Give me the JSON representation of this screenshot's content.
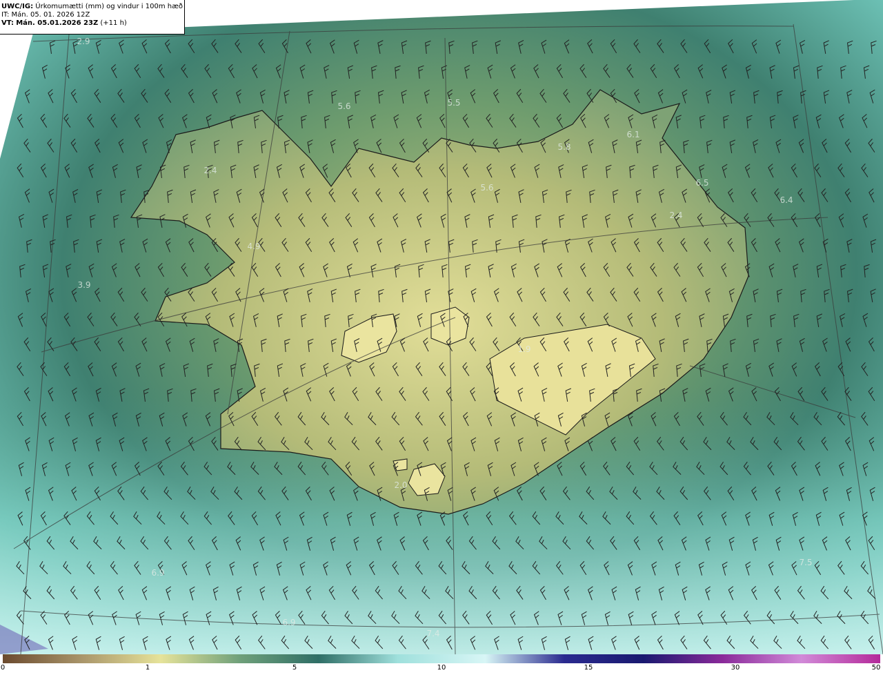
{
  "title": {
    "product": "UWC/IG:",
    "description": "Úrkomumætti (mm) og vindur i 100m hæð",
    "it": "IT: Mán. 05. 01. 2026 12Z",
    "vt_prefix": "VT:",
    "vt_value": "Mán. 05.01.2026 23Z",
    "vt_offset": "(+11 h)"
  },
  "value_labels": [
    "2.9",
    "5.6",
    "5.5",
    "6.1",
    "5.8",
    "2.4",
    "5.6",
    "6.5",
    "6.4",
    "2.4",
    "4.9",
    "3.9",
    "1.9",
    "2.0",
    "6.9",
    "6.9",
    "7.5",
    "7.4"
  ],
  "colorbar": {
    "ticks": [
      "0",
      "1",
      "5",
      "10",
      "15",
      "30",
      "50"
    ],
    "colors": [
      "#6b4a2e",
      "#a9956a",
      "#e6e39a",
      "#6fa07a",
      "#2f6e66",
      "#9fe0dc",
      "#d8f6f6",
      "#2a2a8f",
      "#191970",
      "#8a2a9a",
      "#d18ad8",
      "#b42a9a"
    ]
  },
  "background_color": "#ffffff",
  "field_colors": {
    "land": "#c6c982",
    "sea_near": "#4a8a78",
    "sea_far": "#9fe0d8"
  }
}
